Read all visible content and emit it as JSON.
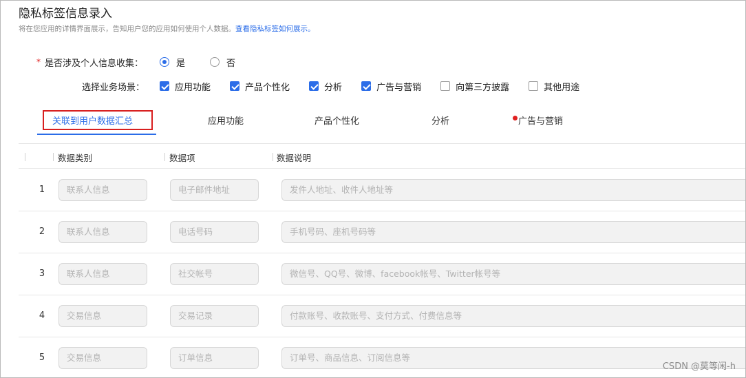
{
  "header": {
    "title": "隐私标签信息录入",
    "subtitle": "将在您应用的详情界面展示，告知用户您的应用如何使用个人数据。",
    "subtitle_link": "查看隐私标签如何展示。"
  },
  "question": {
    "required_mark": "*",
    "label": "是否涉及个人信息收集：",
    "options": [
      {
        "label": "是",
        "checked": true
      },
      {
        "label": "否",
        "checked": false
      }
    ]
  },
  "scenarios": {
    "label": "选择业务场景：",
    "options": [
      {
        "label": "应用功能",
        "checked": true
      },
      {
        "label": "产品个性化",
        "checked": true
      },
      {
        "label": "分析",
        "checked": true
      },
      {
        "label": "广告与营销",
        "checked": true
      },
      {
        "label": "向第三方披露",
        "checked": false
      },
      {
        "label": "其他用途",
        "checked": false
      }
    ]
  },
  "tabs": [
    {
      "label": "关联到用户数据汇总",
      "active": true
    },
    {
      "label": "应用功能",
      "active": false
    },
    {
      "label": "产品个性化",
      "active": false
    },
    {
      "label": "分析",
      "active": false
    },
    {
      "label": "广告与营销",
      "active": false,
      "has_dot": true
    }
  ],
  "table": {
    "columns": [
      "数据类别",
      "数据项",
      "数据说明"
    ],
    "rows": [
      {
        "index": "1",
        "category": "联系人信息",
        "item": "电子邮件地址",
        "desc": "发件人地址、收件人地址等"
      },
      {
        "index": "2",
        "category": "联系人信息",
        "item": "电话号码",
        "desc": "手机号码、座机号码等"
      },
      {
        "index": "3",
        "category": "联系人信息",
        "item": "社交帐号",
        "desc": "微信号、QQ号、微博、facebook帐号、Twitter帐号等"
      },
      {
        "index": "4",
        "category": "交易信息",
        "item": "交易记录",
        "desc": "付款账号、收款账号、支付方式、付费信息等"
      },
      {
        "index": "5",
        "category": "交易信息",
        "item": "订单信息",
        "desc": "订单号、商品信息、订阅信息等"
      }
    ]
  },
  "watermark": "CSDN @莫等闲-h",
  "colors": {
    "accent": "#2b6de8",
    "highlight_border": "#d81e1e",
    "dot": "#e02020"
  }
}
